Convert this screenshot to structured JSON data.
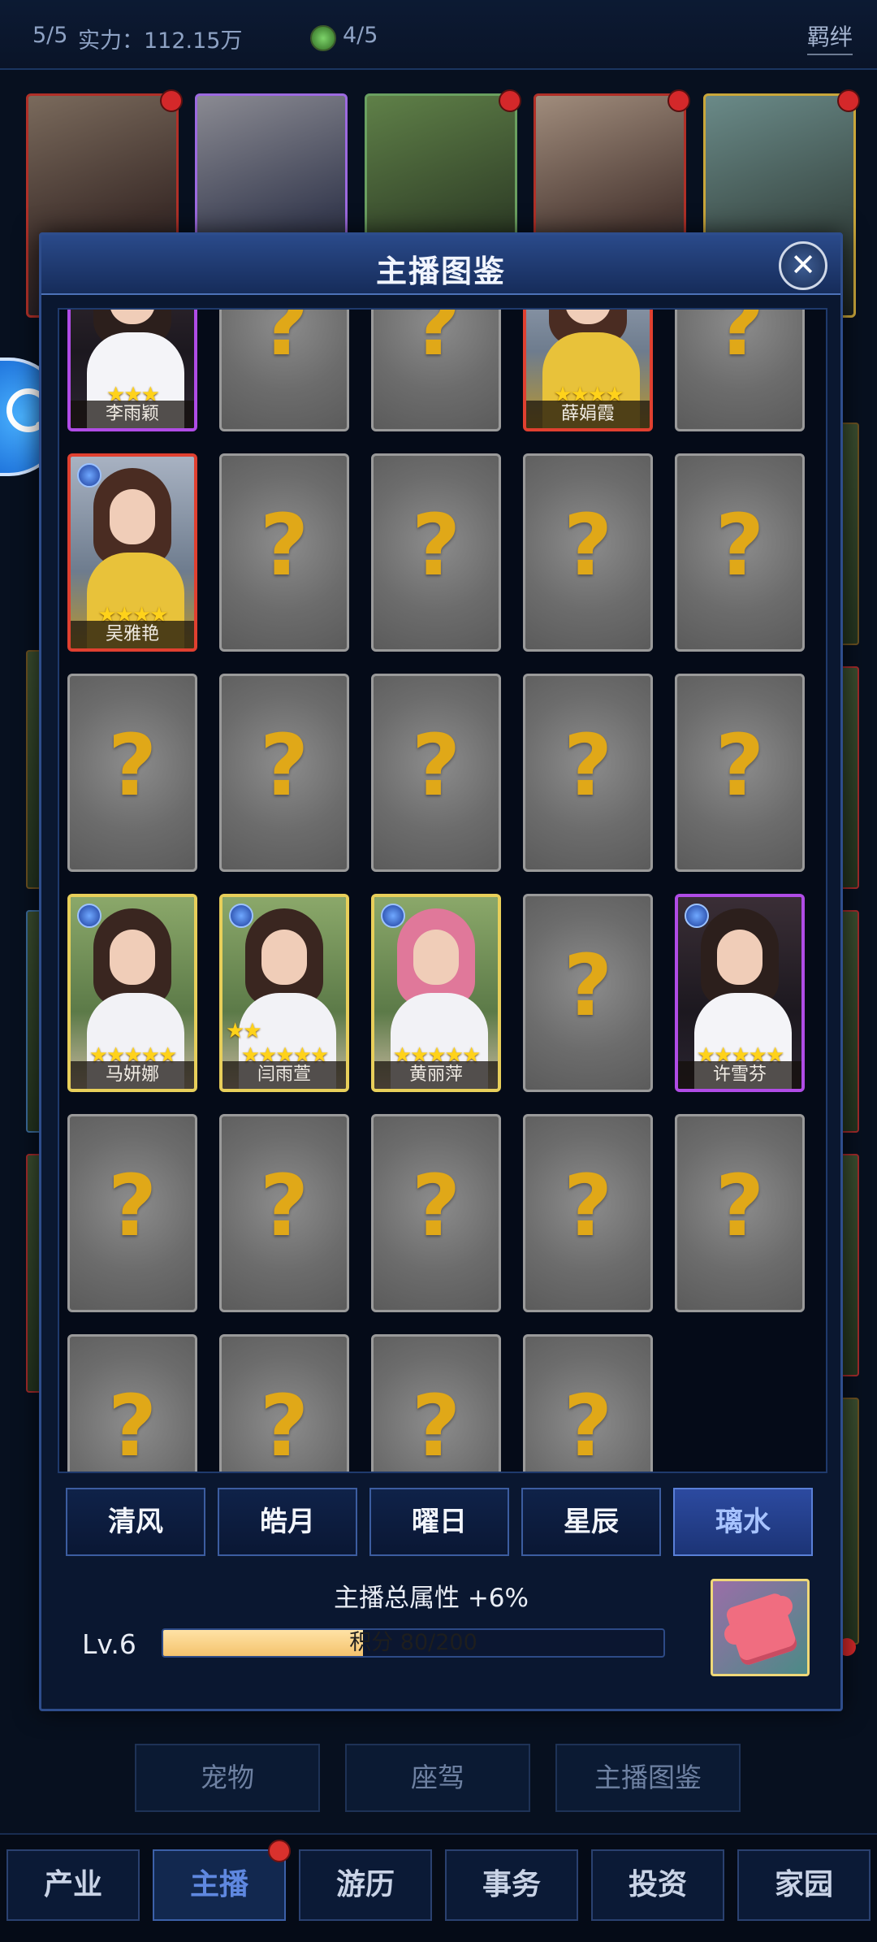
{
  "top_bar": {
    "count": "5/5",
    "power": "实力：112.15万",
    "slots": "4/5",
    "bond": "羁绊"
  },
  "modal": {
    "title": "主播图鉴",
    "close_icon": "close-icon",
    "cards": [
      {
        "owned": true,
        "name": "李雨颖",
        "stars": 3,
        "frame": "violet"
      },
      {
        "owned": false,
        "name": ""
      },
      {
        "owned": false,
        "name": ""
      },
      {
        "owned": true,
        "name": "薛娟霞",
        "stars": 4,
        "frame": "red"
      },
      {
        "owned": false,
        "name": ""
      },
      {
        "owned": true,
        "name": "吴雅艳",
        "stars": 4,
        "frame": "red",
        "element": "blue-badge-icon"
      },
      {
        "owned": false,
        "name": ""
      },
      {
        "owned": false,
        "name": ""
      },
      {
        "owned": false,
        "name": ""
      },
      {
        "owned": false,
        "name": ""
      },
      {
        "owned": false,
        "name": ""
      },
      {
        "owned": false,
        "name": ""
      },
      {
        "owned": false,
        "name": ""
      },
      {
        "owned": false,
        "name": ""
      },
      {
        "owned": false,
        "name": ""
      },
      {
        "owned": true,
        "name": "马妍娜",
        "stars": 5,
        "frame": "gold",
        "element": "blue-badge-icon"
      },
      {
        "owned": true,
        "name": "闫雨萱",
        "stars": 7,
        "frame": "gold",
        "element": "blue-badge-icon"
      },
      {
        "owned": true,
        "name": "黄丽萍",
        "stars": 5,
        "frame": "gold",
        "element": "blue-badge-icon"
      },
      {
        "owned": false,
        "name": ""
      },
      {
        "owned": true,
        "name": "许雪芬",
        "stars": 5,
        "frame": "violet",
        "element": "blue-badge-icon"
      },
      {
        "owned": false,
        "name": ""
      },
      {
        "owned": false,
        "name": ""
      },
      {
        "owned": false,
        "name": ""
      },
      {
        "owned": false,
        "name": ""
      },
      {
        "owned": false,
        "name": ""
      },
      {
        "owned": false,
        "name": ""
      },
      {
        "owned": false,
        "name": ""
      },
      {
        "owned": false,
        "name": ""
      },
      {
        "owned": false,
        "name": ""
      }
    ],
    "tabs": [
      "清风",
      "皓月",
      "曜日",
      "星辰",
      "璃水"
    ],
    "active_tab": "璃水",
    "attribute_text": "主播总属性 +6%",
    "level": "Lv.6",
    "progress_text": "积分 80/200",
    "progress_value": 0.4
  },
  "sub_buttons": [
    "宠物",
    "座驾",
    "主播图鉴"
  ],
  "bottom_nav": [
    "产业",
    "主播",
    "游历",
    "事务",
    "投资",
    "家园"
  ],
  "bottom_nav_active": "主播",
  "colors": {
    "modal_bg": "#0a1730",
    "accent": "#2e4d8c",
    "star": "#ffd21a",
    "question_mark": "#e0a818",
    "active_tab_text": "#a7c3ff"
  }
}
